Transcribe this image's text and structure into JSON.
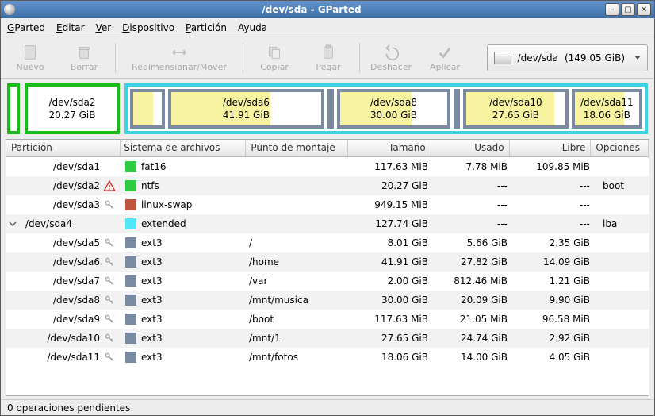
{
  "window": {
    "title": "/dev/sda - GParted"
  },
  "menu": {
    "gparted": "GParted",
    "editar": "Editar",
    "ver": "Ver",
    "dispositivo": "Dispositivo",
    "particion": "Partición",
    "ayuda": "Ayuda"
  },
  "toolbar": {
    "nuevo": "Nuevo",
    "borrar": "Borrar",
    "redim": "Redimensionar/Mover",
    "copiar": "Copiar",
    "pegar": "Pegar",
    "deshacer": "Deshacer",
    "aplicar": "Aplicar"
  },
  "device": {
    "label": "/dev/sda",
    "size": "(149.05 GiB)"
  },
  "diagram": {
    "p0": {
      "name": "/dev/sda2",
      "size": "20.27 GiB"
    },
    "subs": [
      {
        "name": "/dev/sda6",
        "size": "41.91 GiB"
      },
      {
        "name": "/dev/sda8",
        "size": "30.00 GiB"
      },
      {
        "name": "/dev/sda10",
        "size": "27.65 GiB"
      },
      {
        "name": "/dev/sda11",
        "size": "18.06 GiB"
      }
    ]
  },
  "headers": {
    "particion": "Partición",
    "fs": "Sistema de archivos",
    "montaje": "Punto de montaje",
    "tamano": "Tamaño",
    "usado": "Usado",
    "libre": "Libre",
    "opciones": "Opciones"
  },
  "rows": [
    {
      "part": "/dev/sda1",
      "icon": "none",
      "color": "#2ecc40",
      "fs": "fat16",
      "mnt": "",
      "size": "117.63 MiB",
      "used": "7.78 MiB",
      "free": "109.85 MiB",
      "opt": ""
    },
    {
      "part": "/dev/sda2",
      "icon": "warn",
      "color": "#2ecc40",
      "fs": "ntfs",
      "mnt": "",
      "size": "20.27 GiB",
      "used": "---",
      "free": "---",
      "opt": "boot"
    },
    {
      "part": "/dev/sda3",
      "icon": "key",
      "color": "#c0553f",
      "fs": "linux-swap",
      "mnt": "",
      "size": "949.15 MiB",
      "used": "---",
      "free": "---",
      "opt": ""
    },
    {
      "part": "/dev/sda4",
      "icon": "expand",
      "color": "#55e5f9",
      "fs": "extended",
      "mnt": "",
      "size": "127.74 GiB",
      "used": "---",
      "free": "---",
      "opt": "lba"
    },
    {
      "part": "/dev/sda5",
      "icon": "key",
      "color": "#7a8aa0",
      "fs": "ext3",
      "mnt": "/",
      "size": "8.01 GiB",
      "used": "5.66 GiB",
      "free": "2.35 GiB",
      "opt": "",
      "indent": true
    },
    {
      "part": "/dev/sda6",
      "icon": "key",
      "color": "#7a8aa0",
      "fs": "ext3",
      "mnt": "/home",
      "size": "41.91 GiB",
      "used": "27.82 GiB",
      "free": "14.09 GiB",
      "opt": "",
      "indent": true
    },
    {
      "part": "/dev/sda7",
      "icon": "key",
      "color": "#7a8aa0",
      "fs": "ext3",
      "mnt": "/var",
      "size": "2.00 GiB",
      "used": "812.46 MiB",
      "free": "1.21 GiB",
      "opt": "",
      "indent": true
    },
    {
      "part": "/dev/sda8",
      "icon": "key",
      "color": "#7a8aa0",
      "fs": "ext3",
      "mnt": "/mnt/musica",
      "size": "30.00 GiB",
      "used": "20.09 GiB",
      "free": "9.90 GiB",
      "opt": "",
      "indent": true
    },
    {
      "part": "/dev/sda9",
      "icon": "key",
      "color": "#7a8aa0",
      "fs": "ext3",
      "mnt": "/boot",
      "size": "117.63 MiB",
      "used": "21.05 MiB",
      "free": "96.58 MiB",
      "opt": "",
      "indent": true
    },
    {
      "part": "/dev/sda10",
      "icon": "key",
      "color": "#7a8aa0",
      "fs": "ext3",
      "mnt": "/mnt/1",
      "size": "27.65 GiB",
      "used": "24.74 GiB",
      "free": "2.92 GiB",
      "opt": "",
      "indent": true
    },
    {
      "part": "/dev/sda11",
      "icon": "key",
      "color": "#7a8aa0",
      "fs": "ext3",
      "mnt": "/mnt/fotos",
      "size": "18.06 GiB",
      "used": "14.00 GiB",
      "free": "4.05 GiB",
      "opt": "",
      "indent": true
    }
  ],
  "status": "0 operaciones pendientes"
}
